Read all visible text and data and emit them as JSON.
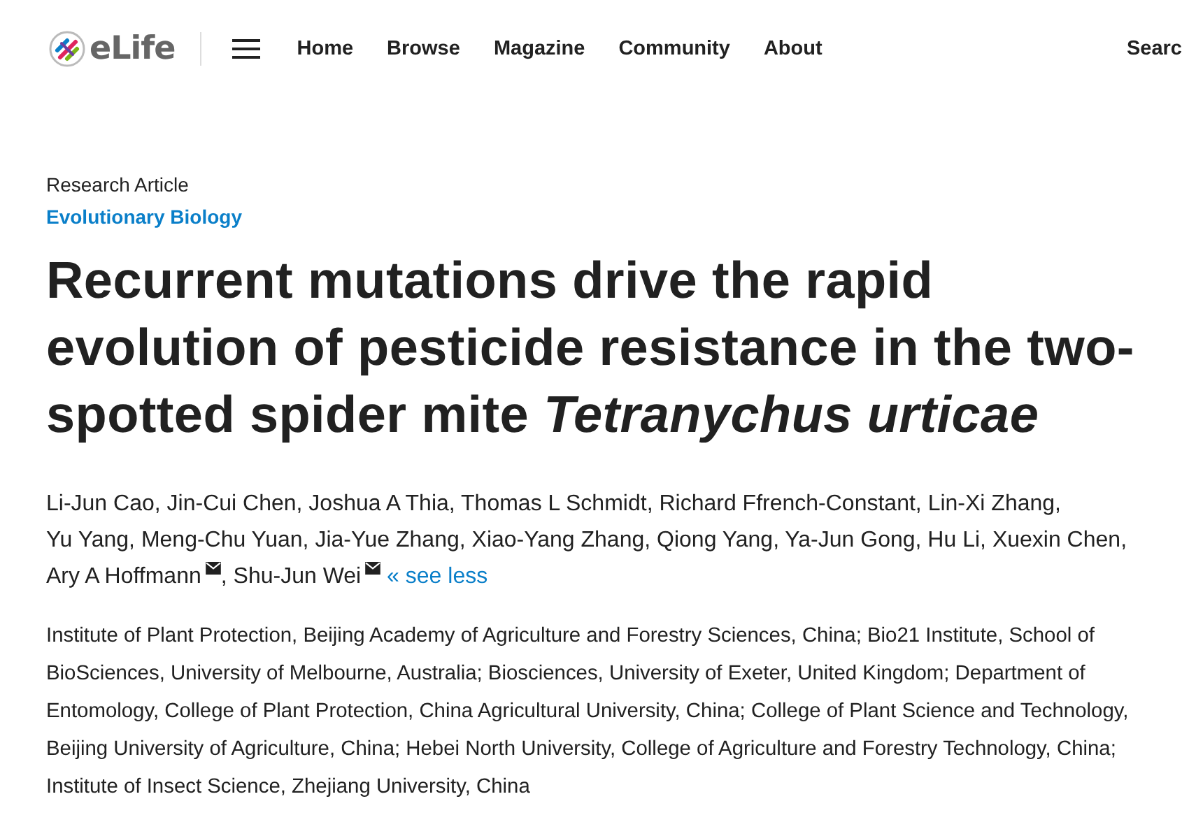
{
  "header": {
    "logo_text": "eLife",
    "nav": [
      {
        "label": "Home"
      },
      {
        "label": "Browse"
      },
      {
        "label": "Magazine"
      },
      {
        "label": "Community"
      },
      {
        "label": "About"
      }
    ],
    "search_label": "Searc"
  },
  "article": {
    "type": "Research Article",
    "subject": "Evolutionary Biology",
    "title": "Recurrent mutations drive the rapid evolution of pesticide resistance in the two-spotted spider mite *Tetranychus urticae*",
    "authors": [
      {
        "name": "Li-Jun Cao",
        "email": false,
        "separator": ","
      },
      {
        "name": "Jin-Cui Chen",
        "email": false,
        "separator": ","
      },
      {
        "name": "Joshua A Thia",
        "email": false,
        "separator": ","
      },
      {
        "name": "Thomas L Schmidt",
        "email": false,
        "separator": ","
      },
      {
        "name": "Richard Ffrench-Constant",
        "email": false,
        "separator": ","
      },
      {
        "name": "Lin-Xi Zhang",
        "email": false,
        "separator": ","
      },
      {
        "name": "Yu Yang",
        "email": false,
        "separator": ","
      },
      {
        "name": "Meng-Chu Yuan",
        "email": false,
        "separator": ","
      },
      {
        "name": "Jia-Yue Zhang",
        "email": false,
        "separator": ","
      },
      {
        "name": "Xiao-Yang Zhang",
        "email": false,
        "separator": ","
      },
      {
        "name": "Qiong Yang",
        "email": false,
        "separator": ","
      },
      {
        "name": "Ya-Jun Gong",
        "email": false,
        "separator": ","
      },
      {
        "name": "Hu Li",
        "email": false,
        "separator": ","
      },
      {
        "name": "Xuexin Chen",
        "email": false,
        "separator": ","
      },
      {
        "name": "Ary A Hoffmann",
        "email": true,
        "separator": ","
      },
      {
        "name": "Shu-Jun Wei",
        "email": true
      }
    ],
    "see_less": "« see less",
    "affiliations": "Institute of Plant Protection, Beijing Academy of Agriculture and Forestry Sciences, China; Bio21 Institute, School of BioSciences, University of Melbourne, Australia; Biosciences, University of Exeter, United Kingdom; Department of Entomology, College of Plant Protection, China Agricultural University, China; College of Plant Science and Technology, Beijing University of Agriculture, China; Hebei North University, College of Agriculture and Forestry Technology, China; Institute of Insect Science, Zhejiang University, China"
  }
}
